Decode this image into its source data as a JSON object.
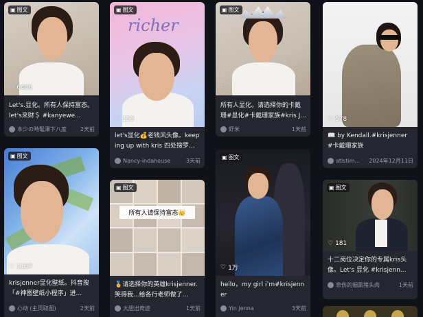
{
  "badge_label": "图文",
  "colors": {
    "page_bg": "#111219",
    "card_bg": "#25262f",
    "muted": "#9a9aa6"
  },
  "icons": {
    "badge": "image-text-icon",
    "like": "heart-outline-icon",
    "avatar": "avatar-circle"
  },
  "cards": [
    {
      "likes": "6406",
      "title": "Let's.显化。所有人保持富态。let's来财＄ #kanyewe...",
      "author": "本少の時髦澤下八度",
      "time": "2天前"
    },
    {
      "likes": "153",
      "title": "let's显化💰老钱风头像。keeping up with kris 四处搜罗...",
      "author": "Nancy-indahouse",
      "time": "3天前",
      "image_text": "richer"
    },
    {
      "likes": "",
      "title": "所有人显化。请选择你的卡戴珊#显化#卡戴珊家族#kris J...",
      "author": "虾米",
      "time": "1天前"
    },
    {
      "likes": "578",
      "title": "📖 by Kendall.#krisjenner #卡戴珊家族",
      "author": "atlstim...",
      "time": "2024年12月11日"
    },
    {
      "likes": "1157",
      "title": "krisjenner显化壁纸。抖音搜「#神图壁纸小程序」进...",
      "author": "心动 (主页取图)",
      "time": "2天前"
    },
    {
      "likes": "",
      "title": "🏅请选择你的英雄krisjenner.笑得我...给各行老师做了...",
      "author": "大胆出奇迹",
      "time": "1天前",
      "image_text": "所有人请保持富态👑"
    },
    {
      "likes": "1万",
      "title": "hello，my girl i’m#krisjenner",
      "author": "Yin Jenna",
      "time": "3天前"
    },
    {
      "likes": "181",
      "title": "十二岗位决定你的专属kris头像。Let's 显化 #krisjenn...",
      "author": "悲伤的烟熏猪头肉",
      "time": "1天前"
    }
  ]
}
